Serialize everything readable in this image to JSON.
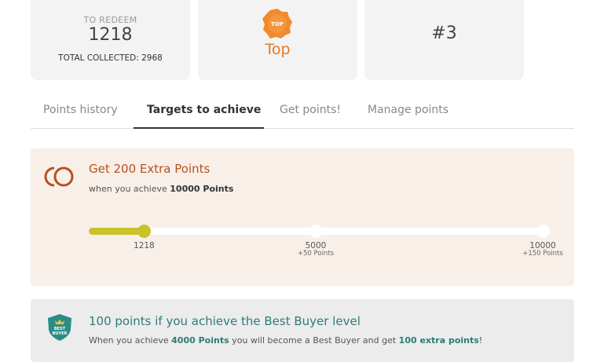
{
  "cards": {
    "redeem_label": "TO REDEEM",
    "redeem_value": "1218",
    "total_collected": "TOTAL COLLECTED: 2968",
    "badge_text": "TOP",
    "level_label": "Top",
    "rank": "#3"
  },
  "tabs": {
    "items": [
      {
        "label": "Points history"
      },
      {
        "label": "Targets to achieve",
        "active": true
      },
      {
        "label": "Get points!"
      },
      {
        "label": "Manage points"
      }
    ]
  },
  "target1": {
    "title": "Get 200 Extra Points",
    "sub_prefix": "when you achieve ",
    "sub_bold": "10000 Points",
    "progress_fraction": 0.1218,
    "milestones": [
      {
        "value": "1218",
        "bonus": ""
      },
      {
        "value": "5000",
        "bonus": "+50 Points"
      },
      {
        "value": "10000",
        "bonus": "+150 Points"
      }
    ]
  },
  "target2": {
    "title": "100 points if you achieve the Best Buyer level",
    "badge_text": "BEST BUYER",
    "sub_1": "When you achieve ",
    "sub_bold_1": "4000 Points",
    "sub_2": " you will become a Best Buyer and get ",
    "sub_bold_2": "100 extra points",
    "sub_3": "!"
  },
  "colors": {
    "accent_orange": "#e07a25",
    "accent_brown": "#b8511b",
    "progress_olive": "#c8c32a",
    "accent_teal": "#2a7d7a"
  },
  "icons": {
    "top_badge": "top-badge-icon",
    "ring": "rings-icon",
    "best_buyer": "best-buyer-shield-icon"
  }
}
